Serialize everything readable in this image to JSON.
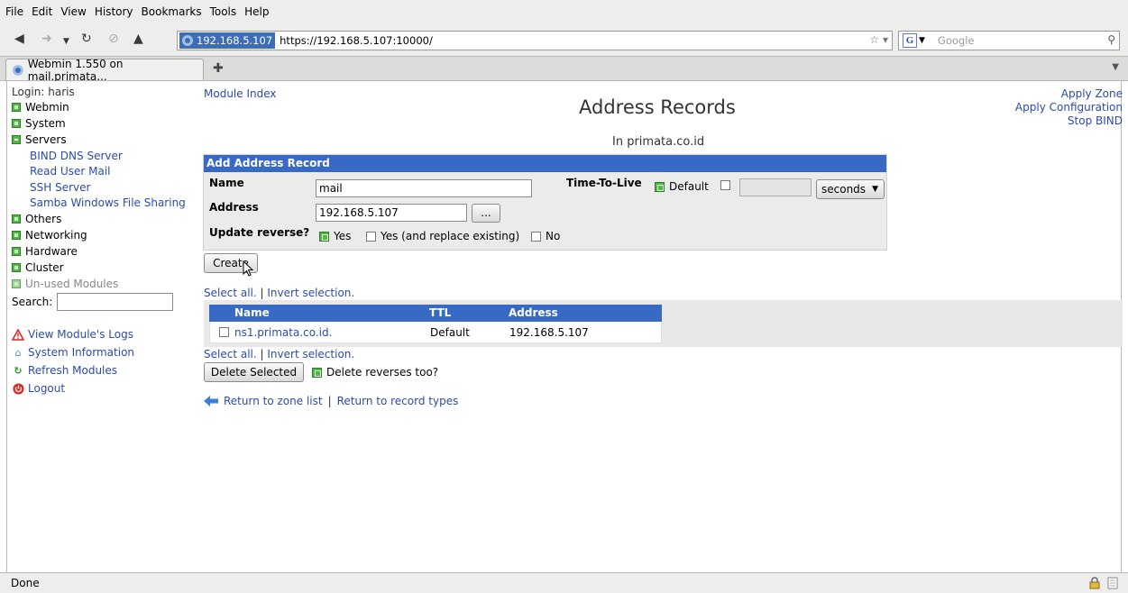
{
  "browser": {
    "menu": [
      "File",
      "Edit",
      "View",
      "History",
      "Bookmarks",
      "Tools",
      "Help"
    ],
    "url_site": "192.168.5.107",
    "url": "https://192.168.5.107:10000/",
    "search_placeholder": "Google",
    "tab_title": "Webmin 1.550 on mail.primata...",
    "status": "Done"
  },
  "sidebar": {
    "login": "Login: haris",
    "categories": [
      {
        "label": "Webmin"
      },
      {
        "label": "System"
      },
      {
        "label": "Servers"
      },
      {
        "label": "Others"
      },
      {
        "label": "Networking"
      },
      {
        "label": "Hardware"
      },
      {
        "label": "Cluster"
      },
      {
        "label": "Un-used Modules"
      }
    ],
    "server_modules": [
      "BIND DNS Server",
      "Read User Mail",
      "SSH Server",
      "Samba Windows File Sharing"
    ],
    "search_label": "Search:",
    "links": [
      "View Module's Logs",
      "System Information",
      "Refresh Modules",
      "Logout"
    ]
  },
  "main": {
    "module_index": "Module Index",
    "right_links": [
      "Apply Zone",
      "Apply Configuration",
      "Stop BIND"
    ],
    "title": "Address Records",
    "subtitle": "In primata.co.id",
    "form": {
      "header": "Add Address Record",
      "name_label": "Name",
      "name_value": "mail",
      "address_label": "Address",
      "address_value": "192.168.5.107",
      "browse_label": "...",
      "ttl_label": "Time-To-Live",
      "ttl_default": "Default",
      "ttl_unit": "seconds",
      "reverse_label": "Update reverse?",
      "reverse_yes": "Yes",
      "reverse_replace": "Yes (and replace existing)",
      "reverse_no": "No",
      "create_label": "Create"
    },
    "select_all": "Select all.",
    "invert_selection": "Invert selection.",
    "table": {
      "columns": [
        "Name",
        "TTL",
        "Address"
      ],
      "rows": [
        {
          "name": "ns1.primata.co.id.",
          "ttl": "Default",
          "address": "192.168.5.107"
        }
      ]
    },
    "delete_selected": "Delete Selected",
    "delete_reverses": "Delete reverses too?",
    "return_zone": "Return to zone list",
    "return_types": "Return to record types"
  }
}
